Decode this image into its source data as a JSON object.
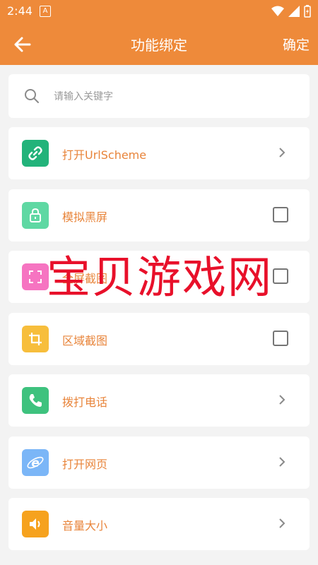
{
  "status_bar": {
    "time": "2:44",
    "notification_glyph": "A"
  },
  "app_bar": {
    "title": "功能绑定",
    "confirm_label": "确定"
  },
  "search": {
    "placeholder": "请输入关键字",
    "value": ""
  },
  "items": [
    {
      "label": "打开UrlScheme",
      "icon": "link-icon",
      "icon_color": "#22b37a",
      "trailing": "chevron"
    },
    {
      "label": "模拟黑屏",
      "icon": "lock-icon",
      "icon_color": "#5fd8a3",
      "trailing": "checkbox",
      "checked": false
    },
    {
      "label": "全屏截图",
      "icon": "fullscreen-capture-icon",
      "icon_color": "#f674c1",
      "trailing": "checkbox",
      "checked": false
    },
    {
      "label": "区域截图",
      "icon": "crop-icon",
      "icon_color": "#f7be3c",
      "trailing": "checkbox",
      "checked": false
    },
    {
      "label": "拨打电话",
      "icon": "phone-icon",
      "icon_color": "#3ec27e",
      "trailing": "chevron"
    },
    {
      "label": "打开网页",
      "icon": "browser-icon",
      "icon_color": "#7bb6f7",
      "trailing": "chevron"
    },
    {
      "label": "音量大小",
      "icon": "volume-icon",
      "icon_color": "#f6a21e",
      "trailing": "chevron"
    }
  ],
  "watermark": "宝贝游戏网",
  "colors": {
    "accent": "#ee8a3a",
    "label_text": "#e8843a",
    "background": "#f3f3f3"
  }
}
